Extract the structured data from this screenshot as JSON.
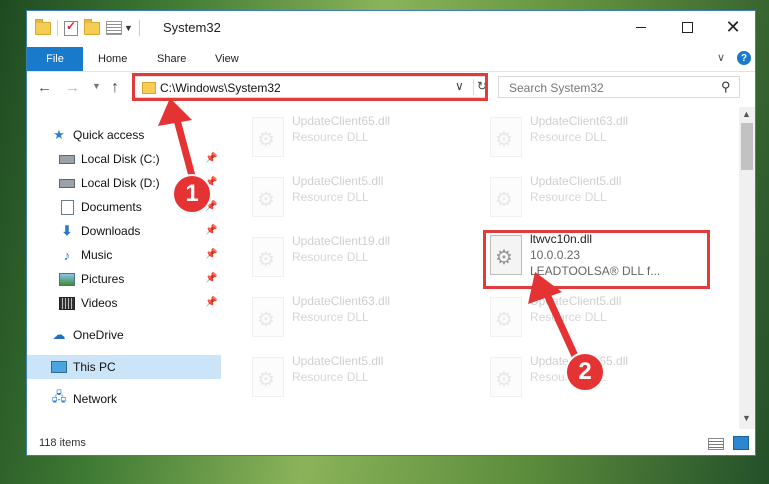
{
  "window": {
    "title": "System32",
    "controls": {
      "minimize": "",
      "maximize": "",
      "close": "✕"
    }
  },
  "ribbon": {
    "tabs": [
      "File",
      "Home",
      "Share",
      "View"
    ],
    "help": "?"
  },
  "address_bar": {
    "path": "C:\\Windows\\System32",
    "search_placeholder": "Search System32"
  },
  "nav_pane": {
    "items": [
      {
        "label": "Quick access",
        "icon": "star-icon",
        "pinned": false
      },
      {
        "label": "Local Disk (C:)",
        "icon": "drive-icon",
        "pinned": true
      },
      {
        "label": "Local Disk (D:)",
        "icon": "drive-icon",
        "pinned": true
      },
      {
        "label": "Documents",
        "icon": "document-icon",
        "pinned": true
      },
      {
        "label": "Downloads",
        "icon": "download-icon",
        "pinned": true
      },
      {
        "label": "Music",
        "icon": "music-icon",
        "pinned": true
      },
      {
        "label": "Pictures",
        "icon": "pictures-icon",
        "pinned": true
      },
      {
        "label": "Videos",
        "icon": "videos-icon",
        "pinned": true
      },
      {
        "label": "OneDrive",
        "icon": "cloud-icon",
        "pinned": false
      },
      {
        "label": "This PC",
        "icon": "computer-icon",
        "pinned": false,
        "selected": true
      },
      {
        "label": "Network",
        "icon": "network-icon",
        "pinned": false
      }
    ]
  },
  "files": [
    {
      "name": "UpdateClient65.dll",
      "desc": "Resource DLL"
    },
    {
      "name": "UpdateClient63.dll",
      "desc": "Resource DLL"
    },
    {
      "name": "UpdateClient5.dll",
      "desc": "Resource DLL"
    },
    {
      "name": "UpdateClient5.dll",
      "desc": "Resource DLL"
    },
    {
      "name": "UpdateClient19.dll",
      "desc": "Resource DLL"
    },
    {
      "name": "ltwvc10n.dll",
      "desc": "10.0.0.23",
      "desc2": "LEADTOOLSA® DLL f...",
      "highlighted": true
    },
    {
      "name": "UpdateClient63.dll",
      "desc": "Resource DLL"
    },
    {
      "name": "UpdateClient5.dll",
      "desc": "Resource DLL"
    },
    {
      "name": "UpdateClient5.dll",
      "desc": "Resource DLL"
    },
    {
      "name": "UpdateClient65.dll",
      "desc": "Resource DLL"
    }
  ],
  "status_bar": {
    "item_count": "118 items"
  },
  "annotations": {
    "badge1": "1",
    "badge2": "2",
    "color": "#e23b3b"
  }
}
